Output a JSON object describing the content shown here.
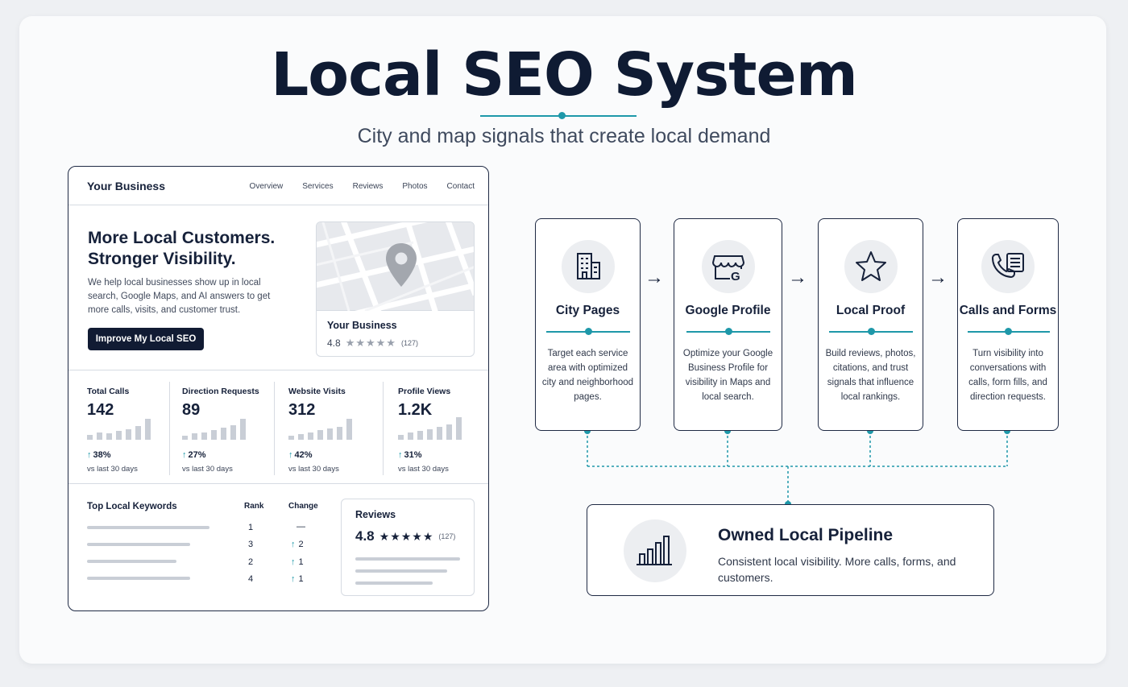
{
  "header": {
    "title": "Local SEO System",
    "subtitle": "City and map signals that create local demand"
  },
  "mockup": {
    "brand": "Your Business",
    "nav_links": [
      "Overview",
      "Services",
      "Reviews",
      "Photos",
      "Contact"
    ],
    "hero_heading": "More Local Customers. Stronger Visibility.",
    "hero_text": "We help local businesses show up in local search, Google Maps, and AI answers to get more calls, visits, and customer trust.",
    "cta_label": "Improve My Local SEO",
    "map_card": {
      "business_name": "Your Business",
      "rating": "4.8",
      "stars": "★★★★★",
      "review_count": "(127)"
    },
    "metrics": [
      {
        "label": "Total Calls",
        "value": "142",
        "delta": "38%",
        "delta_arrow": "↑",
        "sub": "vs last 30 days"
      },
      {
        "label": "Direction Requests",
        "value": "89",
        "delta": "27%",
        "delta_arrow": "↑",
        "sub": "vs last 30 days"
      },
      {
        "label": "Website Visits",
        "value": "312",
        "delta": "42%",
        "delta_arrow": "↑",
        "sub": "vs last 30 days"
      },
      {
        "label": "Profile Views",
        "value": "1.2K",
        "delta": "31%",
        "delta_arrow": "↑",
        "sub": "vs last 30 days"
      }
    ],
    "keywords": {
      "title": "Top Local Keywords",
      "rank_header": "Rank",
      "change_header": "Change",
      "rows": [
        {
          "rank": "1",
          "change_arrow": "",
          "change": "—"
        },
        {
          "rank": "3",
          "change_arrow": "↑",
          "change": "2"
        },
        {
          "rank": "2",
          "change_arrow": "↑",
          "change": "1"
        },
        {
          "rank": "4",
          "change_arrow": "↑",
          "change": "1"
        }
      ]
    },
    "reviews": {
      "title": "Reviews",
      "rating": "4.8",
      "stars": "★★★★★",
      "count": "(127)"
    }
  },
  "flow": {
    "steps": [
      {
        "icon": "building-icon",
        "title": "City Pages",
        "description": "Target each service area with optimized city and neighborhood pages."
      },
      {
        "icon": "google-storefront-icon",
        "title": "Google Profile",
        "description": "Optimize your Google Business Profile for visibility in Maps and local search."
      },
      {
        "icon": "star-icon",
        "title": "Local Proof",
        "description": "Build reviews, photos, citations, and trust signals that influence local rankings."
      },
      {
        "icon": "phone-form-icon",
        "title": "Calls and Forms",
        "description": "Turn visibility into conversations with calls, form fills, and direction requests."
      }
    ],
    "arrow": "→",
    "outcome": {
      "icon": "bar-chart-icon",
      "title": "Owned Local Pipeline",
      "description": "Consistent local visibility. More calls, forms, and customers."
    }
  },
  "colors": {
    "navy": "#0f1b33",
    "teal": "#1e98a9",
    "background": "#eef0f3",
    "card": "#fafbfc"
  }
}
